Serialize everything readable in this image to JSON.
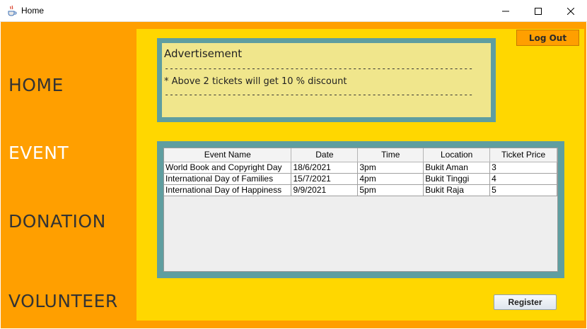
{
  "window": {
    "title": "Home",
    "icon": "java-cup-icon"
  },
  "sidebar": {
    "items": [
      {
        "label": "HOME"
      },
      {
        "label": "EVENT"
      },
      {
        "label": "DONATION"
      },
      {
        "label": "VOLUNTEER"
      }
    ],
    "active_color": "#ffffff",
    "text_color": "#333333"
  },
  "header": {
    "logout_label": "Log Out"
  },
  "advertisement": {
    "title": "Advertisement",
    "divider": "----------------------------------------------------------------",
    "message": "* Above 2 tickets will get 10 % discount"
  },
  "events_table": {
    "columns": [
      "Event Name",
      "Date",
      "Time",
      "Location",
      "Ticket Price"
    ],
    "rows": [
      [
        "World Book and Copyright Day",
        "18/6/2021",
        "3pm",
        "Bukit Aman",
        "3"
      ],
      [
        "International Day of Families",
        "15/7/2021",
        "4pm",
        "Bukit Tinggi",
        "4"
      ],
      [
        "International Day of Happiness",
        "9/9/2021",
        "5pm",
        "Bukit Raja",
        "5"
      ]
    ]
  },
  "actions": {
    "register_label": "Register"
  },
  "colors": {
    "sidebar_bg": "#ff9f00",
    "panel_bg": "#ffd700",
    "frame": "#5f9ea0",
    "ad_bg": "#f0e68c"
  }
}
